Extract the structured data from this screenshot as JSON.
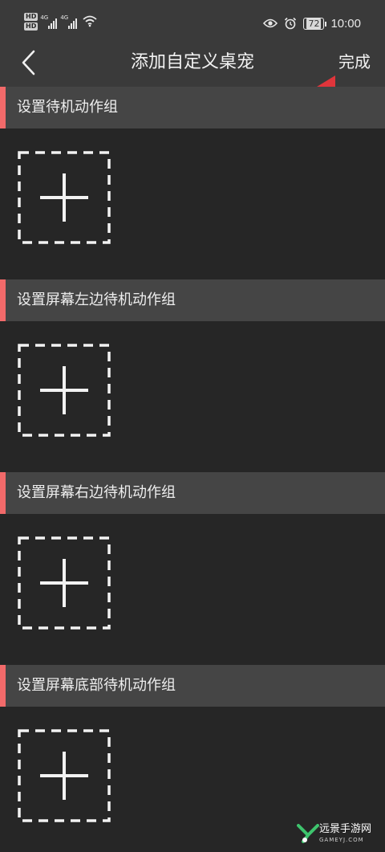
{
  "status_bar": {
    "hd1": "HD",
    "hd2": "HD",
    "net1": "4G",
    "net2": "4G",
    "battery": "72",
    "time": "10:00"
  },
  "header": {
    "title": "添加自定义桌宠",
    "done_label": "完成"
  },
  "sections": [
    {
      "title": "设置待机动作组"
    },
    {
      "title": "设置屏幕左边待机动作组"
    },
    {
      "title": "设置屏幕右边待机动作组"
    },
    {
      "title": "设置屏幕底部待机动作组"
    }
  ],
  "watermark": {
    "name": "远景手游网",
    "url": "GAMEYJ.COM"
  },
  "colors": {
    "accent": "#f26a6a",
    "arrow": "#e0353b",
    "header_bg": "#3a3a3a",
    "section_header_bg": "#454545",
    "body_bg": "#262626"
  },
  "icons": [
    "hd-icon",
    "signal-icon",
    "wifi-icon",
    "eye-icon",
    "alarm-icon",
    "battery-icon",
    "back-chevron-icon",
    "plus-icon",
    "red-arrow"
  ]
}
